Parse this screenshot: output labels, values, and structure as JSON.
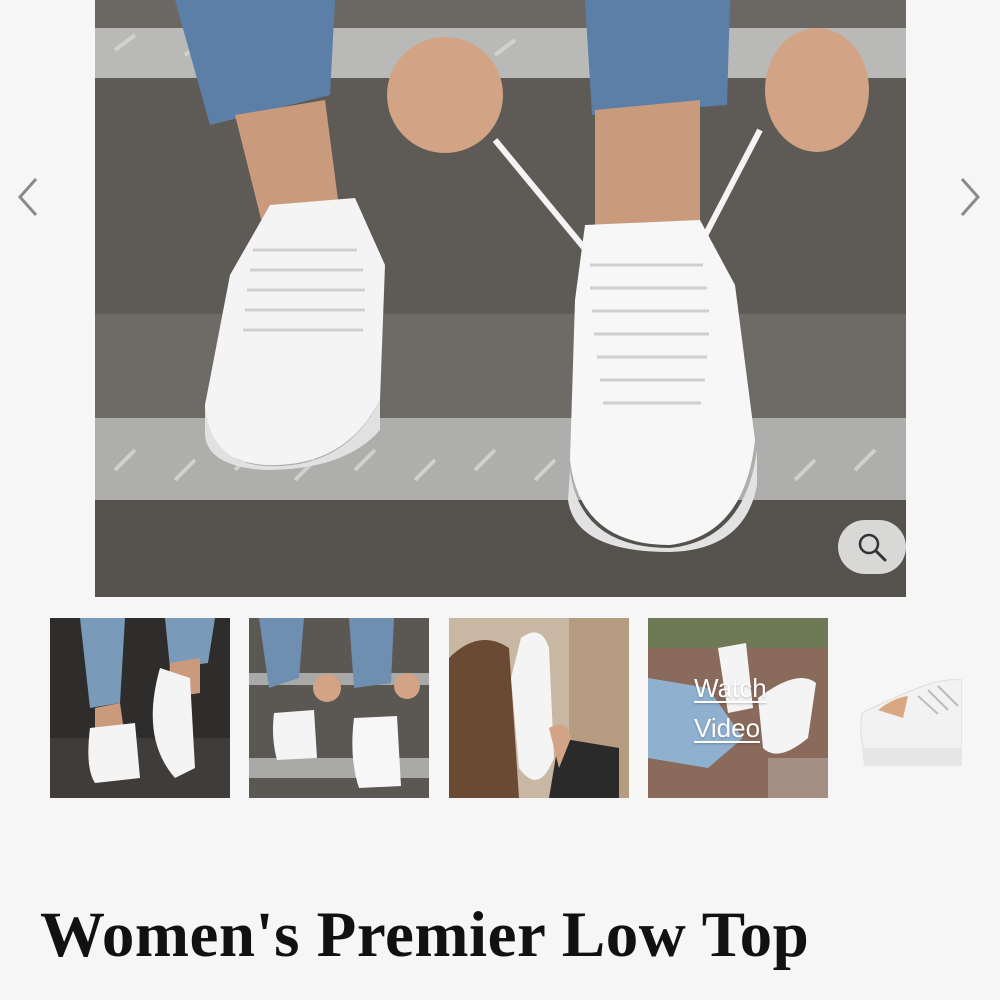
{
  "gallery": {
    "main_image": {
      "icon": "white-sneakers-photo"
    },
    "prev_icon": "chevron-left-icon",
    "next_icon": "chevron-right-icon",
    "zoom_icon": "magnifier-icon",
    "thumbnails": [
      {
        "icon": "sneakers-standing-photo"
      },
      {
        "icon": "sneakers-lacing-photo"
      },
      {
        "icon": "sneaker-held-photo"
      },
      {
        "icon": "video-thumbnail",
        "label": "Watch Video"
      },
      {
        "icon": "sneaker-side-photo"
      }
    ]
  },
  "product": {
    "title": "Women's Premier Low Top"
  },
  "colors": {
    "background": "#f6f6f6",
    "title_text": "#111111",
    "arrow": "#8a8a8a"
  }
}
